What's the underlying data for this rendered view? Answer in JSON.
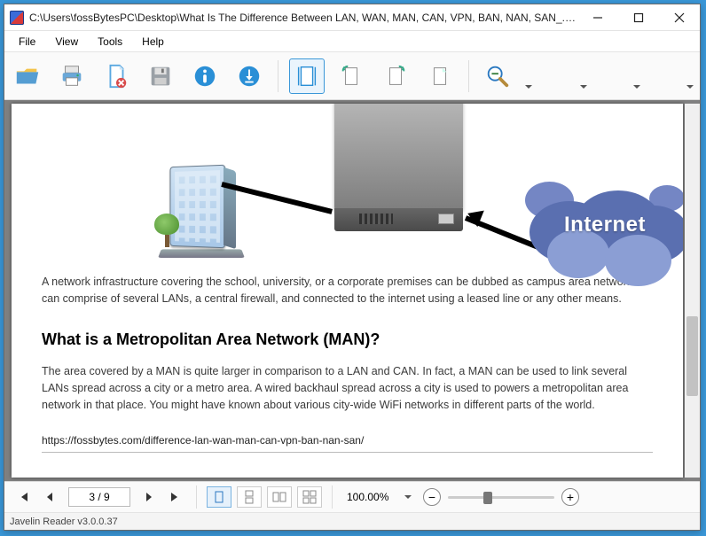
{
  "titlebar": {
    "path": "C:\\Users\\fossBytesPC\\Desktop\\What Is The Difference Between LAN, WAN, MAN, CAN, VPN, BAN, NAN, SAN_.pdf"
  },
  "menu": {
    "file": "File",
    "view": "View",
    "tools": "Tools",
    "help": "Help"
  },
  "doc": {
    "cloud_label": "Internet",
    "para1": "A network infrastructure covering the school, university, or a corporate premises can be dubbed as campus area network. It can comprise of several LANs, a central firewall, and connected to the internet using a leased line or any other means.",
    "heading": "What is a Metropolitan Area Network (MAN)?",
    "para2": "The area covered by a MAN is quite larger in comparison to a LAN and CAN. In fact, a MAN can be used to link several LANs spread across a city or a metro area. A wired backhaul spread across a city is used to powers a metropolitan area network in that place. You might have known about various city-wide WiFi networks in different parts of the world.",
    "footer_url": "https://fossbytes.com/difference-lan-wan-man-can-vpn-ban-nan-san/"
  },
  "nav": {
    "page_display": "3 / 9",
    "zoom": "100.00%"
  },
  "status": {
    "text": "Javelin Reader v3.0.0.37"
  }
}
